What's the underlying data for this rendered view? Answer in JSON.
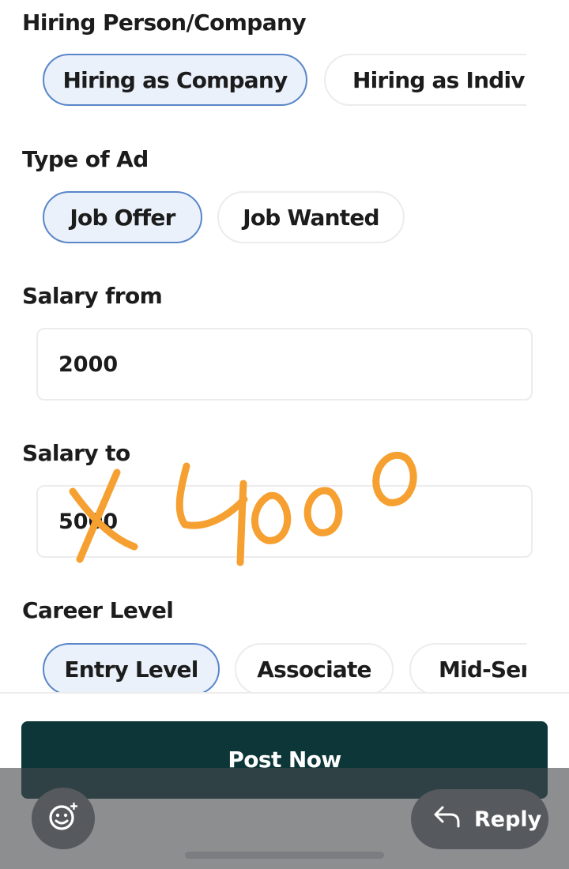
{
  "hiring": {
    "label": "Hiring Person/Company",
    "options": [
      "Hiring as Company",
      "Hiring as Individual"
    ],
    "selected": "Hiring as Company"
  },
  "ad_type": {
    "label": "Type of Ad",
    "options": [
      "Job Offer",
      "Job Wanted"
    ],
    "selected": "Job Offer"
  },
  "salary_from": {
    "label": "Salary from",
    "value": "2000"
  },
  "salary_to": {
    "label": "Salary to",
    "value": "5000"
  },
  "handwritten_note": "4000",
  "career_level": {
    "label": "Career Level",
    "options": [
      "Entry Level",
      "Associate",
      "Mid-Senior"
    ],
    "selected": "Entry Level"
  },
  "post_button": "Post Now",
  "reply_button": "Reply",
  "colors": {
    "selected_chip_bg": "#eaf1fb",
    "selected_chip_border": "#5a86c9",
    "post_button_bg": "#0d3638",
    "annotation": "#f5a031",
    "overlay": "#46484c"
  },
  "icons": {
    "emoji": "emoji-add-icon",
    "reply": "reply-arrow-icon"
  }
}
